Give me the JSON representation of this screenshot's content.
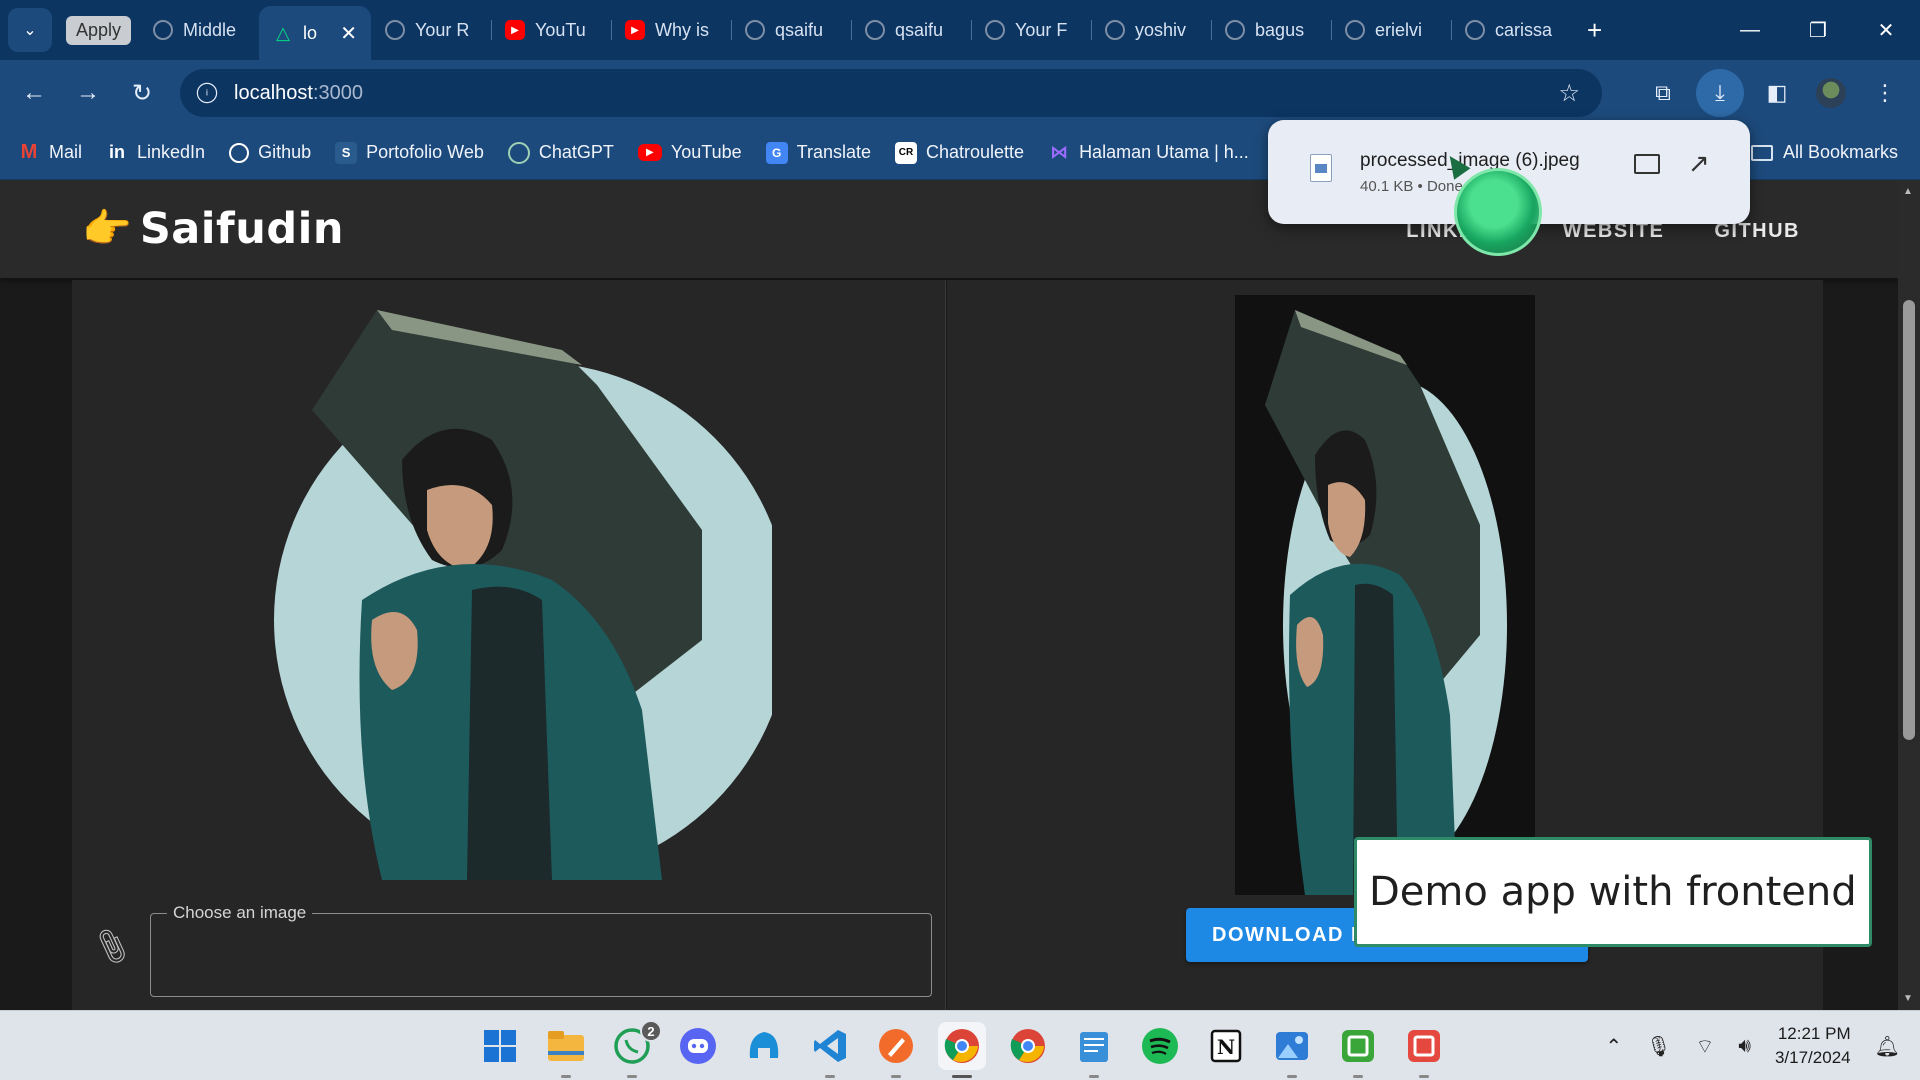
{
  "browser": {
    "tab_group_label": "Apply",
    "tabs": [
      {
        "label": "Middle",
        "icon": "github-icon",
        "active": false
      },
      {
        "label": "lo",
        "icon": "nuxt-icon",
        "active": true
      },
      {
        "label": "Your R",
        "icon": "github-icon",
        "active": false
      },
      {
        "label": "YouTu",
        "icon": "youtube-icon",
        "active": false
      },
      {
        "label": "Why is",
        "icon": "youtube-icon",
        "active": false
      },
      {
        "label": "qsaifu",
        "icon": "github-icon",
        "active": false
      },
      {
        "label": "qsaifu",
        "icon": "github-icon",
        "active": false
      },
      {
        "label": "Your F",
        "icon": "github-icon",
        "active": false
      },
      {
        "label": "yoshiv",
        "icon": "github-icon",
        "active": false
      },
      {
        "label": "bagus",
        "icon": "github-icon",
        "active": false
      },
      {
        "label": "erielvi",
        "icon": "github-icon",
        "active": false
      },
      {
        "label": "carissa",
        "icon": "github-icon",
        "active": false
      }
    ],
    "new_tab_label": "+",
    "url_host": "localhost",
    "url_port": ":3000",
    "bookmarks": [
      {
        "label": "Mail",
        "icon": "gmail-icon"
      },
      {
        "label": "LinkedIn",
        "icon": "linkedin-icon"
      },
      {
        "label": "Github",
        "icon": "github-icon"
      },
      {
        "label": "Portofolio Web",
        "icon": "portfolio-icon"
      },
      {
        "label": "ChatGPT",
        "icon": "chatgpt-icon"
      },
      {
        "label": "YouTube",
        "icon": "youtube-icon"
      },
      {
        "label": "Translate",
        "icon": "translate-icon"
      },
      {
        "label": "Chatroulette",
        "icon": "chatroulette-icon"
      },
      {
        "label": "Halaman Utama | h...",
        "icon": "halaman-icon"
      }
    ],
    "all_bookmarks_label": "All Bookmarks"
  },
  "download": {
    "filename": "processed_image (6).jpeg",
    "meta": "40.1 KB • Done"
  },
  "app": {
    "brand": "Saifudin",
    "brand_emoji": "👉",
    "nav": [
      "LINKEDIN",
      "WEBSITE",
      "GITHUB"
    ],
    "file_input_label": "Choose an image",
    "download_button_label": "DOWNLOAD IMAGE"
  },
  "caption": "Demo app with frontend",
  "taskbar": {
    "whatsapp_badge": "2",
    "time": "12:21 PM",
    "date": "3/17/2024"
  },
  "colors": {
    "tab_strip": "#0d3562",
    "toolbar": "#1d4a7c",
    "page_background": "#1a1a1a",
    "panel": "#262626",
    "download_button": "#1e88e5",
    "caption_border": "#2e8b67"
  }
}
